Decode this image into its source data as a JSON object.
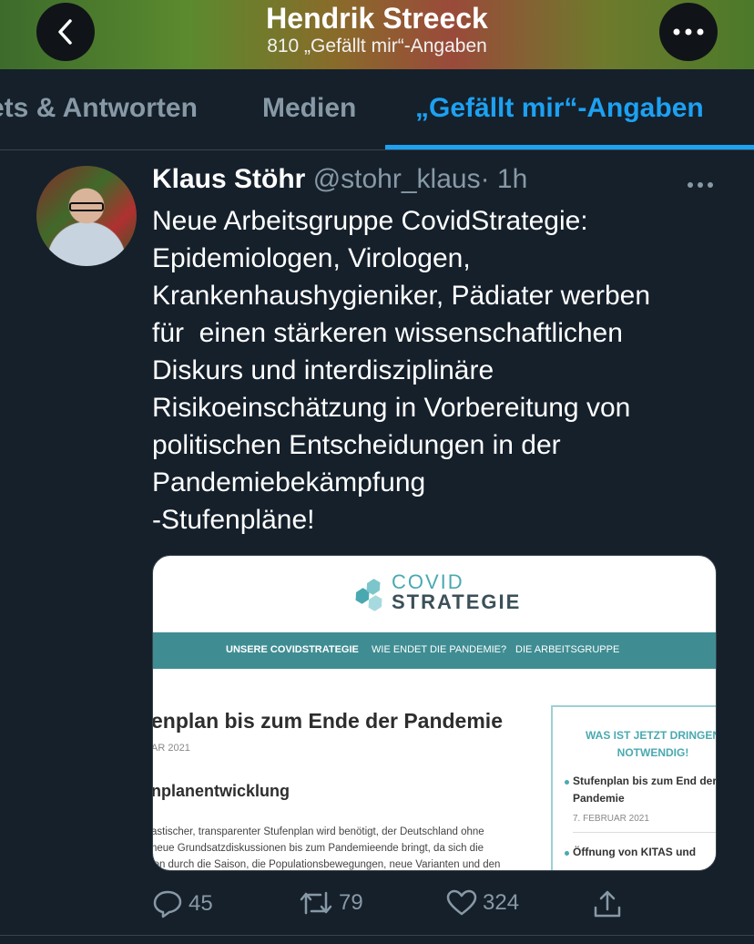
{
  "header": {
    "title": "Hendrik Streeck",
    "subtitle": "810 „Gefällt mir“-Angaben"
  },
  "tabs": [
    {
      "label": "ets & Antworten",
      "active": false
    },
    {
      "label": "Medien",
      "active": false
    },
    {
      "label": "„Gefällt mir“-Angaben",
      "active": true
    }
  ],
  "tweet": {
    "name": "Klaus Stöhr",
    "handle": "@stohr_klaus",
    "time": "· 1h",
    "text": "Neue Arbeitsgruppe CovidStrategie:\nEpidemiologen, Virologen,\nKrankenhaushygieniker, Pädiater werben\nfür  einen stärkeren wissenschaftlichen\nDiskurs und interdisziplinäre\nRisikoeinschätzung in Vorbereitung von\npolitischen Entscheidungen in der\nPandemiebekämpfung\n-Stufenpläne!"
  },
  "card": {
    "logo_top": "COVID",
    "logo_bottom": "STRATEGIE",
    "nav": [
      "UNSERE COVIDSTRATEGIE",
      "WIE ENDET DIE PANDEMIE?",
      "DIE ARBEITSGRUPPE"
    ],
    "article_title": "enplan bis zum Ende der Pandemie",
    "article_date": "AR 2021",
    "article_subtitle": "nplanentwicklung",
    "article_body": [
      "astischer, transparenter Stufenplan wird benötigt, der Deutschland ohne",
      " neue Grundsatzdiskussionen bis zum Pandemieende bringt, da sich die",
      "ion durch die Saison, die Populationsbewegungen, neue Varianten und den"
    ],
    "side_title": "WAS IST JETZT DRINGEN NOTWENDIG!",
    "side_item_1": "Stufenplan bis zum End der Pandemie",
    "side_item_1_date": "7. FEBRUAR 2021",
    "side_item_2": "Öffnung von KITAS und"
  },
  "actions": {
    "replies": "45",
    "retweets": "79",
    "likes": "324"
  },
  "colors": {
    "background": "#15202b",
    "accent": "#1da1f2",
    "muted": "#8899a6",
    "card_teal": "#3f8d93"
  }
}
